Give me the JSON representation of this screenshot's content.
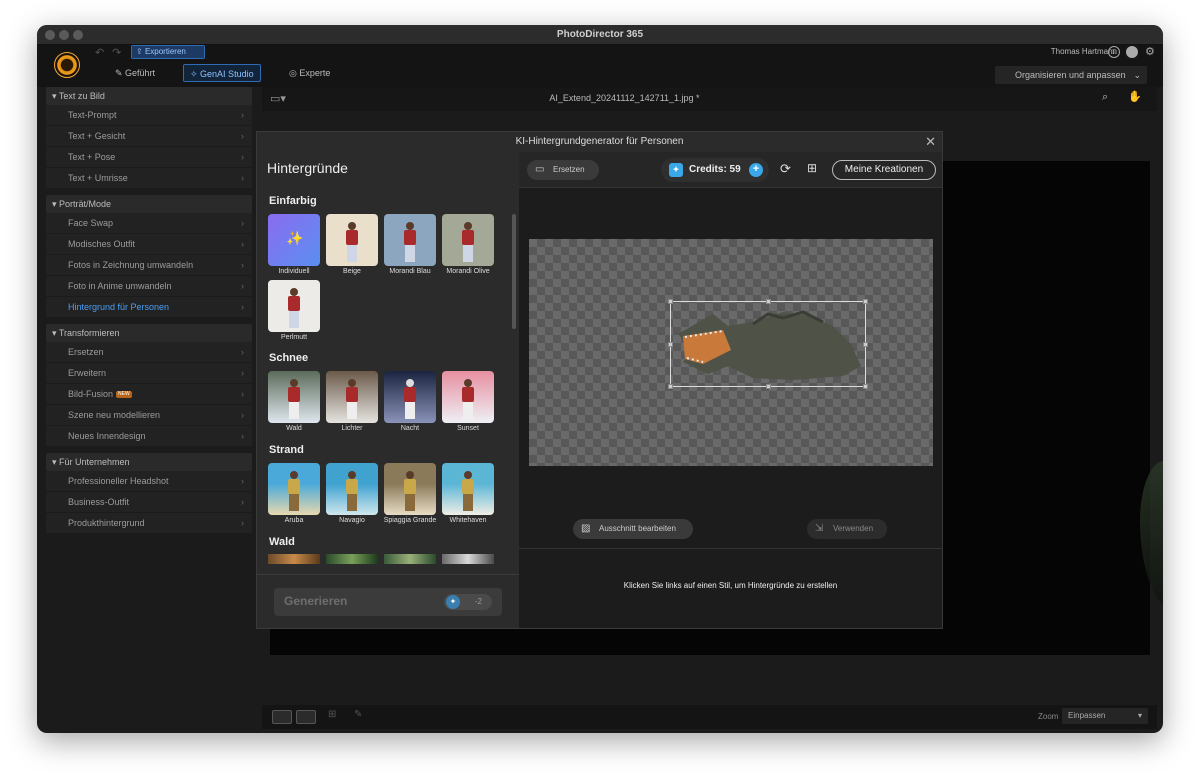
{
  "window": {
    "title": "PhotoDirector 365"
  },
  "toolbar": {
    "export_label": "Exportieren",
    "modes": [
      "Geführt",
      "GenAI Studio",
      "Experte"
    ],
    "user_name": "Thomas Hartmann",
    "organize_label": "Organisieren und anpassen"
  },
  "sidebar": {
    "sections": [
      {
        "title": "Text zu Bild",
        "items": [
          "Text-Prompt",
          "Text + Gesicht",
          "Text + Pose",
          "Text + Umrisse"
        ]
      },
      {
        "title": "Porträt/Mode",
        "items": [
          "Face Swap",
          "Modisches Outfit",
          "Fotos in Zeichnung umwandeln",
          "Foto in Anime umwandeln",
          "Hintergrund für Personen"
        ]
      },
      {
        "title": "Transformieren",
        "items": [
          "Ersetzen",
          "Erweitern",
          "Bild-Fusion",
          "Szene neu modellieren",
          "Neues Innendesign"
        ]
      },
      {
        "title": "Für Unternehmen",
        "items": [
          "Professioneller Headshot",
          "Business-Outfit",
          "Produkthintergrund"
        ]
      }
    ],
    "new_badge": "NEW"
  },
  "main": {
    "filename": "AI_Extend_20241112_142711_1.jpg *",
    "zoom_label": "Zoom",
    "zoom_value": "Einpassen"
  },
  "dialog": {
    "title": "KI-Hintergrundgenerator für Personen",
    "panel_title": "Hintergründe",
    "categories": [
      {
        "title": "Einfarbig",
        "items": [
          "Individuell",
          "Beige",
          "Morandi Blau",
          "Morandi Olive",
          "Perlmutt"
        ]
      },
      {
        "title": "Schnee",
        "items": [
          "Wald",
          "Lichter",
          "Nacht",
          "Sunset"
        ]
      },
      {
        "title": "Strand",
        "items": [
          "Aruba",
          "Navagio",
          "Spiaggia Grande",
          "Whitehaven"
        ]
      },
      {
        "title": "Wald",
        "items": []
      }
    ],
    "generate_label": "Generieren",
    "generate_cost": "-2",
    "replace_label": "Ersetzen",
    "credits_label": "Credits: 59",
    "my_creations_label": "Meine Kreationen",
    "edit_cutout_label": "Ausschnitt bearbeiten",
    "use_label": "Verwenden",
    "hint": "Klicken Sie links auf einen Stil, um Hintergründe zu erstellen"
  },
  "colors": {
    "accent": "#39a7e8",
    "active_item": "#4a9ff5"
  }
}
